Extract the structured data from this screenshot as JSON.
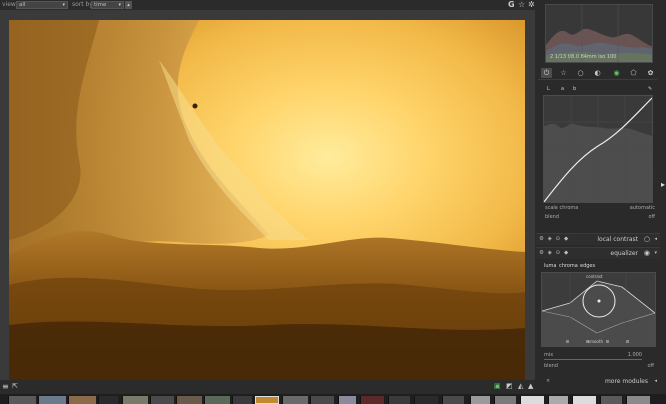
{
  "topbar": {
    "view_label": "view",
    "view_value": "all",
    "sort_label": "sort by",
    "sort_value": "time",
    "icons": [
      "grouping-icon",
      "star-icon",
      "gear-icon"
    ]
  },
  "histogram": {
    "info": "2  1/13  f/8.0  84mm  iso 100"
  },
  "module_tabs": [
    "power-icon",
    "star-icon",
    "circle-icon",
    "half-circle-icon",
    "color-icon",
    "correct-icon",
    "effect-icon"
  ],
  "curve_module": {
    "tabs": [
      "L",
      "a",
      "b"
    ],
    "scale_chroma_label": "scale chroma",
    "scale_chroma_value": "automatic",
    "blend_label": "blend",
    "blend_value": "off"
  },
  "local_contrast": {
    "name": "local contrast"
  },
  "equalizer": {
    "name": "equalizer",
    "tabs": [
      "luma",
      "chroma",
      "edges"
    ],
    "graph_top_label": "contrast",
    "graph_bottom_label": "smooth",
    "mix_label": "mix",
    "mix_value": "1.000",
    "blend_label": "blend",
    "blend_value": "off"
  },
  "more_modules": {
    "label": "more modules"
  },
  "colors": {
    "accent": "#f0a020",
    "panel_bg": "#2a2a2a",
    "center_bg": "#3a3a3a"
  }
}
